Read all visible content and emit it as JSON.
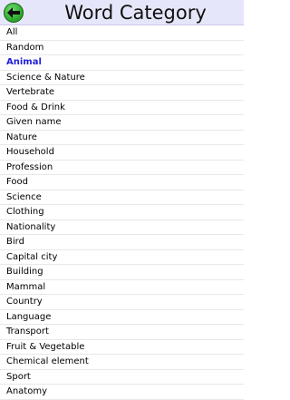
{
  "header": {
    "title": "Word Category",
    "back_icon": "back-arrow-icon"
  },
  "categories": {
    "selected_index": 2,
    "items": [
      "All",
      "Random",
      "Animal",
      "Science & Nature",
      "Vertebrate",
      "Food & Drink",
      "Given name",
      "Nature",
      "Household",
      "Profession",
      "Food",
      "Science",
      "Clothing",
      "Nationality",
      "Bird",
      "Capital city",
      "Building",
      "Mammal",
      "Country",
      "Language",
      "Transport",
      "Fruit & Vegetable",
      "Chemical element",
      "Sport",
      "Anatomy"
    ]
  },
  "colors": {
    "header_bg": "#e6e6fb",
    "selected_text": "#2020d8",
    "back_button": "#2fa82f"
  }
}
